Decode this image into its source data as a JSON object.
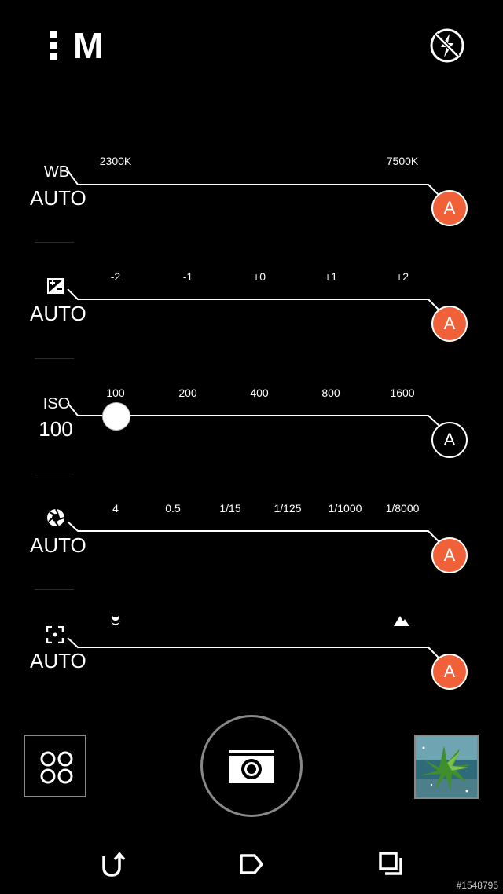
{
  "topbar": {
    "mode_label": "M",
    "menu_icon": "more-vertical-icon",
    "flash_icon": "flash-off-icon"
  },
  "controls": [
    {
      "id": "wb",
      "label": "WB",
      "value": "AUTO",
      "icon": null,
      "ticks": [
        "2300K",
        "7500K"
      ],
      "auto_label": "A",
      "auto_enabled": true
    },
    {
      "id": "exposure",
      "label": "",
      "value": "AUTO",
      "icon": "exposure-compensation-icon",
      "ticks": [
        "-2",
        "-1",
        "+0",
        "+1",
        "+2"
      ],
      "auto_label": "A",
      "auto_enabled": true
    },
    {
      "id": "iso",
      "label": "ISO",
      "value": "100",
      "icon": null,
      "ticks": [
        "100",
        "200",
        "400",
        "800",
        "1600"
      ],
      "auto_label": "A",
      "auto_enabled": false,
      "slider_value": "100"
    },
    {
      "id": "shutter",
      "label": "",
      "value": "AUTO",
      "icon": "aperture-icon",
      "ticks": [
        "4",
        "0.5",
        "1/15",
        "1/125",
        "1/1000",
        "1/8000"
      ],
      "auto_label": "A",
      "auto_enabled": true
    },
    {
      "id": "focus",
      "label": "",
      "value": "AUTO",
      "icon": "focus-icon",
      "ticks_icons": [
        "macro-flower-icon",
        "landscape-mountain-icon"
      ],
      "auto_label": "A",
      "auto_enabled": true
    }
  ],
  "bottom": {
    "modes_icon": "camera-modes-icon",
    "shutter_icon": "camera-icon",
    "thumbnail_icon": "gallery-thumbnail"
  },
  "nav": {
    "back_icon": "back-icon",
    "home_icon": "home-icon",
    "recents_icon": "recents-icon"
  },
  "watermark": "#1548795",
  "colors": {
    "accent": "#f0613a",
    "background": "#000000",
    "foreground": "#ffffff"
  }
}
